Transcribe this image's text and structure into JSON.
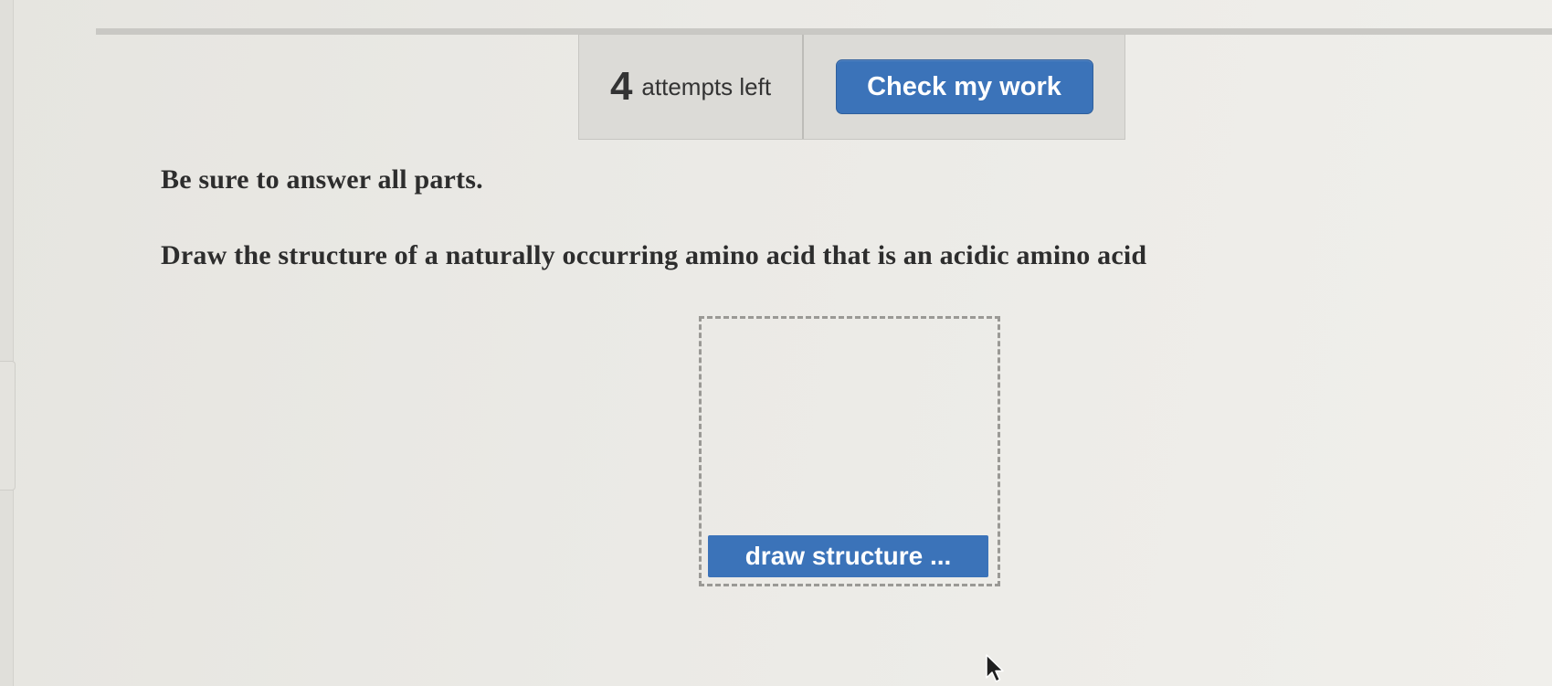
{
  "toolbar": {
    "attempts_count": "4",
    "attempts_label": "attempts left",
    "check_label": "Check my work"
  },
  "question": {
    "instruction": "Be sure to answer all parts.",
    "prompt": "Draw the structure of a naturally occurring amino acid that is an acidic amino acid"
  },
  "drawing": {
    "button_label": "draw structure ..."
  },
  "colors": {
    "accent": "#3b73b9",
    "text": "#2d2d2d"
  },
  "icons": {
    "cursor": "mouse-pointer-icon"
  }
}
